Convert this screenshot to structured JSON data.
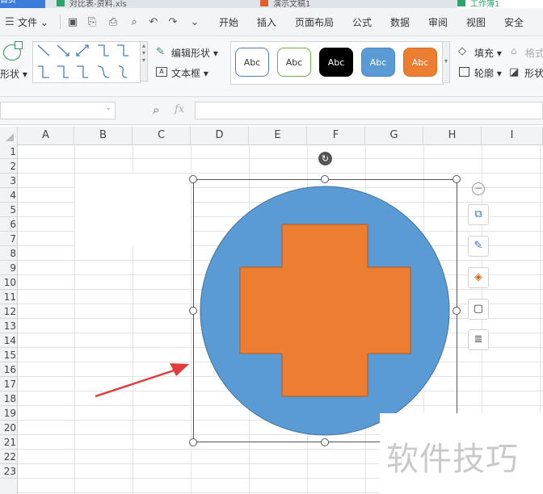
{
  "tabstrip": {
    "tabs": [
      "首页",
      "对比表-资料.xls",
      "演示文稿1",
      "工作簿1"
    ]
  },
  "menubar": {
    "file_label": "文件",
    "tabs": [
      "开始",
      "插入",
      "页面布局",
      "公式",
      "数据",
      "审阅",
      "视图",
      "安全"
    ]
  },
  "ribbon": {
    "shapes_label": "形状",
    "edit_shape_label": "编辑形状",
    "textbox_label": "文本框",
    "style_presets": [
      {
        "text": "Abc",
        "fill": "#ffffff",
        "border": "#4a7ebb",
        "color": "#333333"
      },
      {
        "text": "Abc",
        "fill": "#ffffff",
        "border": "#70ad47",
        "color": "#333333"
      },
      {
        "text": "Abc",
        "fill": "#000000",
        "border": "#000000",
        "color": "#ffffff"
      },
      {
        "text": "Abc",
        "fill": "#5b9bd5",
        "border": "#4a87c2",
        "color": "#ffffff"
      },
      {
        "text": "Abc",
        "fill": "#ed7d31",
        "border": "#d46a22",
        "color": "#ffffff"
      }
    ],
    "fill_label": "填充",
    "format_label": "格式",
    "outline_label": "轮廓",
    "shape_effects_label": "形状"
  },
  "formula_bar": {
    "fx_label": "fx",
    "name_box_value": "",
    "formula_value": ""
  },
  "grid": {
    "columns": [
      "A",
      "B",
      "C",
      "D",
      "E",
      "F",
      "G",
      "H",
      "I"
    ],
    "rows": [
      "1",
      "2",
      "3",
      "4",
      "5",
      "6",
      "7",
      "8",
      "9",
      "10",
      "11",
      "12",
      "13",
      "14",
      "15",
      "16",
      "17",
      "18",
      "19",
      "20",
      "21",
      "22",
      "23"
    ]
  },
  "shape": {
    "circle_color": "#5b9bd5",
    "cross_color": "#ed7d31",
    "arrow_color": "#e03c3c"
  },
  "watermark": {
    "text": "软件技巧"
  }
}
